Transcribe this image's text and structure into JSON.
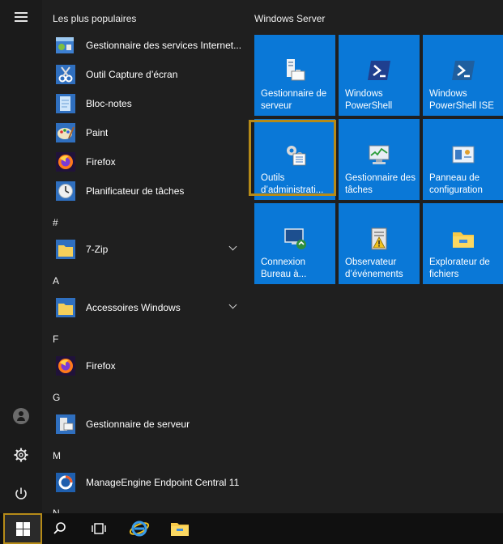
{
  "applist": {
    "most_used_title": "Les plus populaires",
    "most_used": [
      {
        "label": "Gestionnaire des services Internet...",
        "icon": "iis-icon"
      },
      {
        "label": "Outil Capture d’écran",
        "icon": "snipping-tool-icon"
      },
      {
        "label": "Bloc-notes",
        "icon": "notepad-icon"
      },
      {
        "label": "Paint",
        "icon": "paint-icon"
      },
      {
        "label": "Firefox",
        "icon": "firefox-icon"
      },
      {
        "label": "Planificateur de tâches",
        "icon": "task-scheduler-icon"
      }
    ],
    "groups": [
      {
        "letter": "#",
        "items": [
          {
            "label": "7-Zip",
            "icon": "folder-icon",
            "expandable": true
          }
        ]
      },
      {
        "letter": "A",
        "items": [
          {
            "label": "Accessoires Windows",
            "icon": "folder-icon",
            "expandable": true
          }
        ]
      },
      {
        "letter": "F",
        "items": [
          {
            "label": "Firefox",
            "icon": "firefox-icon"
          }
        ]
      },
      {
        "letter": "G",
        "items": [
          {
            "label": "Gestionnaire de serveur",
            "icon": "server-manager-icon"
          }
        ]
      },
      {
        "letter": "M",
        "items": [
          {
            "label": "ManageEngine Endpoint Central 11",
            "icon": "manageengine-icon"
          }
        ]
      },
      {
        "letter": "N",
        "items": []
      }
    ]
  },
  "tiles": {
    "group_title": "Windows Server",
    "items": [
      {
        "label": "Gestionnaire de serveur",
        "icon": "server-manager-icon"
      },
      {
        "label": "Windows PowerShell",
        "icon": "powershell-icon"
      },
      {
        "label": "Windows PowerShell ISE",
        "icon": "powershell-ise-icon"
      },
      {
        "label": "Outils d’administrati...",
        "icon": "admin-tools-icon",
        "highlighted": true
      },
      {
        "label": "Gestionnaire des tâches",
        "icon": "task-manager-icon"
      },
      {
        "label": "Panneau de configuration",
        "icon": "control-panel-icon"
      },
      {
        "label": "Connexion Bureau à...",
        "icon": "remote-desktop-icon"
      },
      {
        "label": "Observateur d’événements",
        "icon": "event-viewer-icon"
      },
      {
        "label": "Explorateur de fichiers",
        "icon": "file-explorer-icon"
      }
    ]
  },
  "rail": {
    "icons": [
      "hamburger-menu-icon",
      "user-avatar-icon",
      "settings-gear-icon",
      "power-icon"
    ]
  },
  "taskbar": {
    "icons": [
      "windows-start-icon",
      "search-icon",
      "task-view-icon",
      "internet-explorer-icon",
      "file-explorer-icon"
    ]
  },
  "colors": {
    "tile_blue": "#0a78d7",
    "highlight": "#b68b18",
    "background": "#1f1f1f"
  }
}
